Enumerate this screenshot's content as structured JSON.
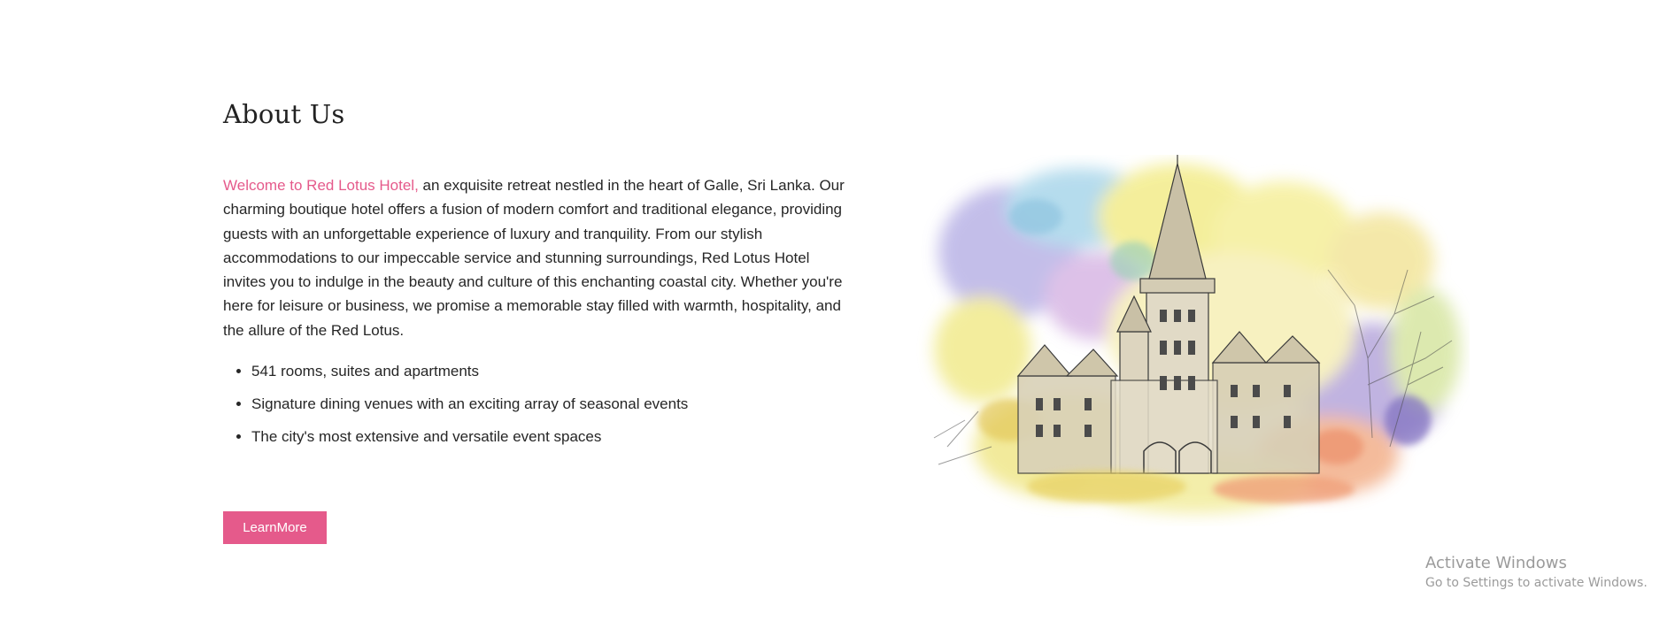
{
  "about": {
    "heading": "About Us",
    "intro_highlight": "Welcome to Red Lotus Hotel,",
    "intro_text": " an exquisite retreat nestled in the heart of Galle, Sri Lanka. Our charming boutique hotel offers a fusion of modern comfort and traditional elegance, providing guests with an unforgettable experience of luxury and tranquility. From our stylish accommodations to our impeccable service and stunning surroundings, Red Lotus Hotel invites you to indulge in the beauty and culture of this enchanting coastal city. Whether you're here for leisure or business, we promise a memorable stay filled with warmth, hospitality, and the allure of the Red Lotus.",
    "features": [
      "541 rooms, suites and apartments",
      "Signature dining venues with an exciting array of seasonal events",
      "The city's most extensive and versatile event spaces"
    ],
    "button_label": "LearnMore"
  },
  "illustration": {
    "subject": "watercolor-castle-hotel"
  },
  "os_overlay": {
    "title": "Activate Windows",
    "subtitle": "Go to Settings to activate Windows."
  },
  "colors": {
    "accent": "#e55a8b",
    "text": "#262626",
    "watermark": "#9b9b9b"
  }
}
